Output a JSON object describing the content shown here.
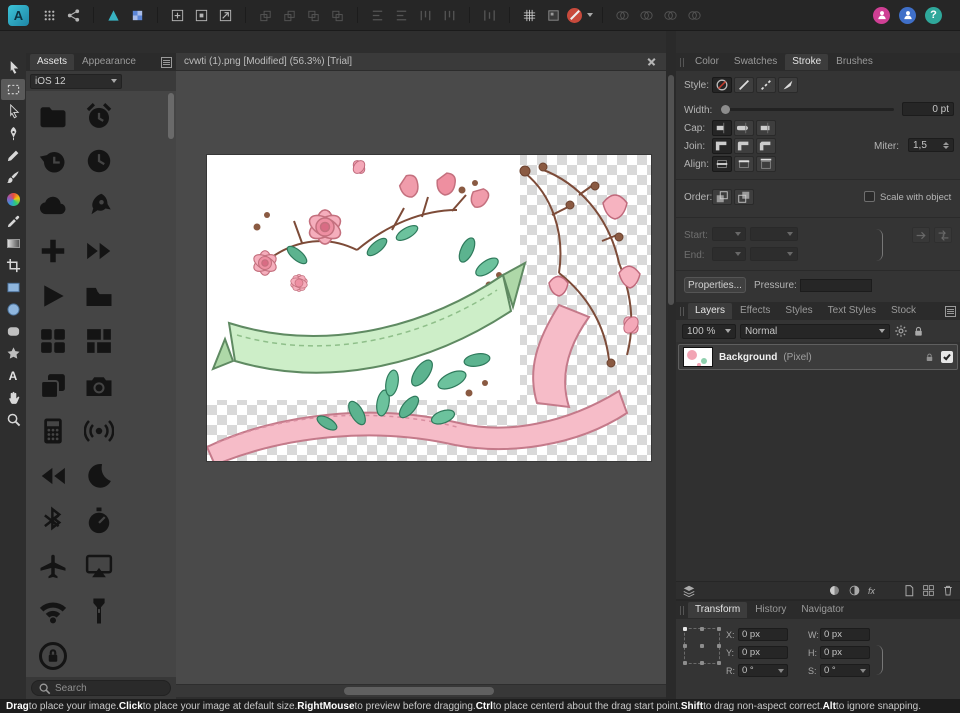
{
  "topbar": {
    "logo_letter": "A",
    "groups": [
      {
        "items": [
          {
            "name": "apps-grid-button",
            "glyph": "dots"
          },
          {
            "name": "share-button",
            "glyph": "share"
          }
        ]
      },
      {
        "items": [
          {
            "name": "persona-vector-button",
            "glyph": "persona-vector"
          },
          {
            "name": "persona-pixel-button",
            "glyph": "persona-pixel"
          }
        ]
      },
      {
        "items": [
          {
            "name": "insert-artboard-button",
            "glyph": "grid-plus"
          },
          {
            "name": "insert-inside-button",
            "glyph": "grid-target"
          },
          {
            "name": "insert-behind-button",
            "glyph": "grid-arrow"
          }
        ]
      },
      {
        "items": [
          {
            "name": "move-to-front-button",
            "glyph": "stack-up",
            "disabled": true
          },
          {
            "name": "move-forward-button",
            "glyph": "stack-up",
            "disabled": true
          },
          {
            "name": "move-backward-button",
            "glyph": "stack-down",
            "disabled": true
          },
          {
            "name": "move-to-back-button",
            "glyph": "stack-down",
            "disabled": true
          }
        ]
      },
      {
        "items": [
          {
            "name": "align-left-button",
            "glyph": "align-h",
            "disabled": true
          },
          {
            "name": "align-center-button",
            "glyph": "align-h",
            "disabled": true
          },
          {
            "name": "align-top-button",
            "glyph": "align-v",
            "disabled": true
          },
          {
            "name": "align-bottom-button",
            "glyph": "align-v",
            "disabled": true
          }
        ]
      },
      {
        "items": [
          {
            "name": "distribute-button",
            "glyph": "distribute",
            "disabled": true
          }
        ]
      },
      {
        "items": [
          {
            "name": "show-grid-button",
            "glyph": "grid"
          },
          {
            "name": "pixel-view-button",
            "glyph": "pixel"
          },
          {
            "name": "snapping-button",
            "glyph": "snap",
            "caret": true
          }
        ]
      },
      {
        "items": [
          {
            "name": "boolean-add-button",
            "glyph": "boolean",
            "disabled": true
          },
          {
            "name": "boolean-subtract-button",
            "glyph": "boolean",
            "disabled": true
          },
          {
            "name": "boolean-intersect-button",
            "glyph": "boolean",
            "disabled": true
          },
          {
            "name": "boolean-divide-button",
            "glyph": "boolean",
            "disabled": true
          }
        ]
      }
    ],
    "account_buttons": [
      {
        "name": "account-button",
        "color": "#cf3f94",
        "glyph": "person",
        "label": ""
      },
      {
        "name": "sync-button",
        "color": "#3f6fc8",
        "glyph": "person",
        "label": ""
      },
      {
        "name": "help-button",
        "color": "#2fa89b",
        "glyph": "text",
        "label": "?"
      }
    ]
  },
  "toolstrip": {
    "text_tool_label": "A",
    "tools": [
      {
        "name": "move-tool",
        "glyph": "cursor",
        "selected": false
      },
      {
        "name": "artboard-tool",
        "glyph": "marquee",
        "selected": true
      },
      {
        "name": "node-tool",
        "glyph": "node-arrow",
        "selected": false
      },
      {
        "name": "pen-tool",
        "glyph": "pen",
        "selected": false
      },
      {
        "name": "pencil-tool",
        "glyph": "pencil",
        "selected": false
      },
      {
        "name": "brush-tool",
        "glyph": "brush",
        "selected": false
      },
      {
        "name": "color-wheel-tool",
        "glyph": "colorwheel",
        "selected": false
      },
      {
        "name": "eyedropper-tool",
        "glyph": "eyedropper",
        "selected": false
      },
      {
        "name": "gradient-tool",
        "glyph": "gradient",
        "selected": false
      },
      {
        "name": "crop-tool",
        "glyph": "crop",
        "selected": false
      },
      {
        "name": "rectangle-tool",
        "glyph": "rect",
        "selected": false
      },
      {
        "name": "ellipse-tool",
        "glyph": "ellipse",
        "selected": false
      },
      {
        "name": "rounded-rectangle-tool",
        "glyph": "roundrect",
        "selected": false
      },
      {
        "name": "shape-tool",
        "glyph": "shape",
        "selected": false
      },
      {
        "name": "text-tool",
        "glyph": "text",
        "selected": false
      },
      {
        "name": "hand-tool",
        "glyph": "hand",
        "selected": false
      },
      {
        "name": "zoom-tool",
        "glyph": "zoom",
        "selected": false
      }
    ]
  },
  "assets_panel": {
    "tabs": [
      {
        "label": "Assets",
        "active": true
      },
      {
        "label": "Appearance",
        "active": false
      }
    ],
    "category": "iOS 12",
    "search_placeholder": "Search",
    "icons": [
      "folder",
      "alarm-clock",
      "history",
      "clock",
      "cloud",
      "rocket",
      "plus",
      "fast-forward",
      "play",
      "folder-fill",
      "grid4",
      "tiles",
      "copy",
      "camera",
      "calculator",
      "antenna",
      "rewind",
      "moon",
      "bluetooth",
      "stopwatch",
      "airplane",
      "airplay",
      "wifi",
      "flashlight",
      "lock"
    ]
  },
  "document": {
    "tab_title": "cvwti (1).png [Modified] (56.3%) [Trial]"
  },
  "stroke_panel": {
    "tabs": [
      "Color",
      "Swatches",
      "Stroke",
      "Brushes"
    ],
    "active_tab": "Stroke",
    "style_label": "Style:",
    "width_label": "Width:",
    "width_value": "0 pt",
    "cap_label": "Cap:",
    "join_label": "Join:",
    "miter_label": "Miter:",
    "miter_value": "1,5",
    "align_label": "Align:",
    "order_label": "Order:",
    "scale_with_object_label": "Scale with object",
    "start_label": "Start:",
    "end_label": "End:",
    "properties_button": "Properties...",
    "pressure_label": "Pressure:"
  },
  "layers_panel": {
    "tabs": [
      "Layers",
      "Effects",
      "Styles",
      "Text Styles",
      "Stock"
    ],
    "active_tab": "Layers",
    "opacity_value": "100 %",
    "blend_mode": "Normal",
    "fx_label": "fx",
    "layers": [
      {
        "name": "Background",
        "type": "(Pixel)",
        "visible": true
      }
    ]
  },
  "transform_panel": {
    "tabs": [
      "Transform",
      "History",
      "Navigator"
    ],
    "active_tab": "Transform",
    "fields": [
      {
        "label": "X:",
        "value": "0 px",
        "caret": false
      },
      {
        "label": "W:",
        "value": "0 px",
        "caret": false
      },
      {
        "label": "Y:",
        "value": "0 px",
        "caret": false
      },
      {
        "label": "H:",
        "value": "0 px",
        "caret": false
      },
      {
        "label": "R:",
        "value": "0 °",
        "caret": true
      },
      {
        "label": "S:",
        "value": "0 °",
        "caret": true
      }
    ]
  },
  "status_bar": {
    "segments": [
      {
        "key": "Drag",
        "text": " to place your image. "
      },
      {
        "key": "Click",
        "text": " to place your image at default size. "
      },
      {
        "key": "RightMouse",
        "text": " to preview before dragging. "
      },
      {
        "key": "Ctrl",
        "text": " to place centerd about the drag start point. "
      },
      {
        "key": "Shift",
        "text": " to drag non-aspect correct. "
      },
      {
        "key": "Alt",
        "text": " to ignore snapping."
      }
    ]
  }
}
